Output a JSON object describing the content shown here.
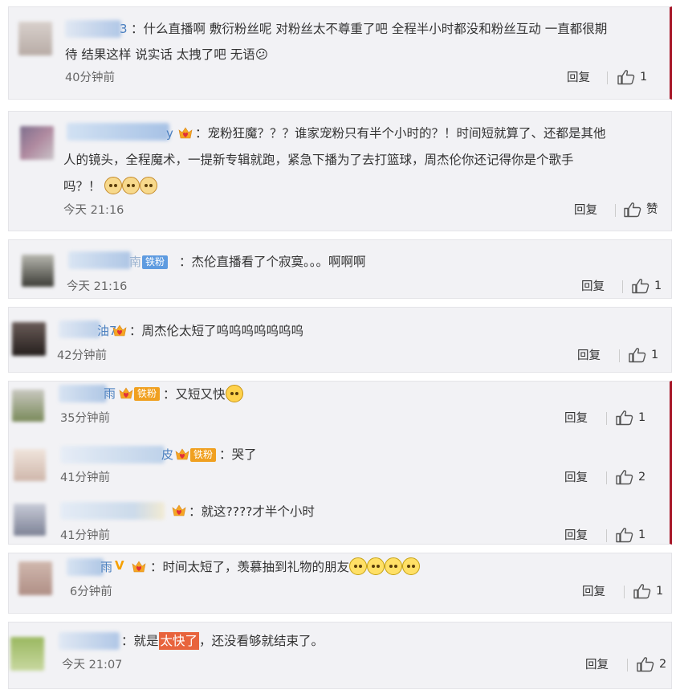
{
  "comments": [
    {
      "name_tail": "3",
      "text_lines": [
        "：什么直播啊 敷衍粉丝呢 对粉丝太不尊重了吧 全程半小时都没和粉丝互动 一直都很期",
        "待 结果这样 说实话 太拽了吧 无语😕"
      ],
      "time": "40分钟前",
      "reply_label": "回复",
      "like_count": "1"
    },
    {
      "name_tail": "y",
      "text_lines": [
        "：宠粉狂魔？？？谁家宠粉只有半个小时的？！时间短就算了、还都是其他",
        "人的镜头，全程魔术，一提新专辑就跑，紧急下播为了去打篮球，周杰伦你还记得你是个歌手",
        "吗？！"
      ],
      "time": "今天 21:16",
      "reply_label": "回复",
      "like_label": "赞"
    },
    {
      "name_tail": "南",
      "fan_badge": "铁粉",
      "text": "：杰伦直播看了个寂寞。。。啊啊啊",
      "time": "今天 21:16",
      "reply_label": "回复",
      "like_count": "1"
    },
    {
      "name_tail": "油7",
      "text": "：周杰伦太短了呜呜呜呜呜呜呜",
      "time": "42分钟前",
      "reply_label": "回复",
      "like_count": "1"
    },
    {
      "name_tail": "雨",
      "fan_badge": "铁粉",
      "text": "：又短又快",
      "time": "35分钟前",
      "reply_label": "回复",
      "like_count": "1"
    },
    {
      "name_tail": "皮",
      "fan_badge": "铁粉",
      "text": "：哭了",
      "time": "41分钟前",
      "reply_label": "回复",
      "like_count": "2"
    },
    {
      "name_tail": "",
      "text": "：就这????才半个小时",
      "time": "41分钟前",
      "reply_label": "回复",
      "like_count": "1"
    },
    {
      "name_tail": "雨",
      "v_badge": "V",
      "text": "：时间太短了，羡慕抽到礼物的朋友",
      "time": "6分钟前",
      "reply_label": "回复",
      "like_count": "1"
    },
    {
      "name_tail": "",
      "text_before": "：就是",
      "text_highlight": "太快了",
      "text_after": "，还没看够就结束了。",
      "time": "今天 21:07",
      "reply_label": "回复",
      "like_count": "2"
    }
  ],
  "colors": {
    "link": "#4a7fbf",
    "highlight": "#e8643d",
    "accent_bar": "#a8182a",
    "card_bg": "#f2f2f5"
  },
  "icons": {
    "like": "thumb-up-icon",
    "vip": "crown-heart-icon",
    "emoji_dog": "doge-emoji",
    "emoji_smile": "smile-emoji",
    "emoji_cool": "cool-emoji"
  }
}
